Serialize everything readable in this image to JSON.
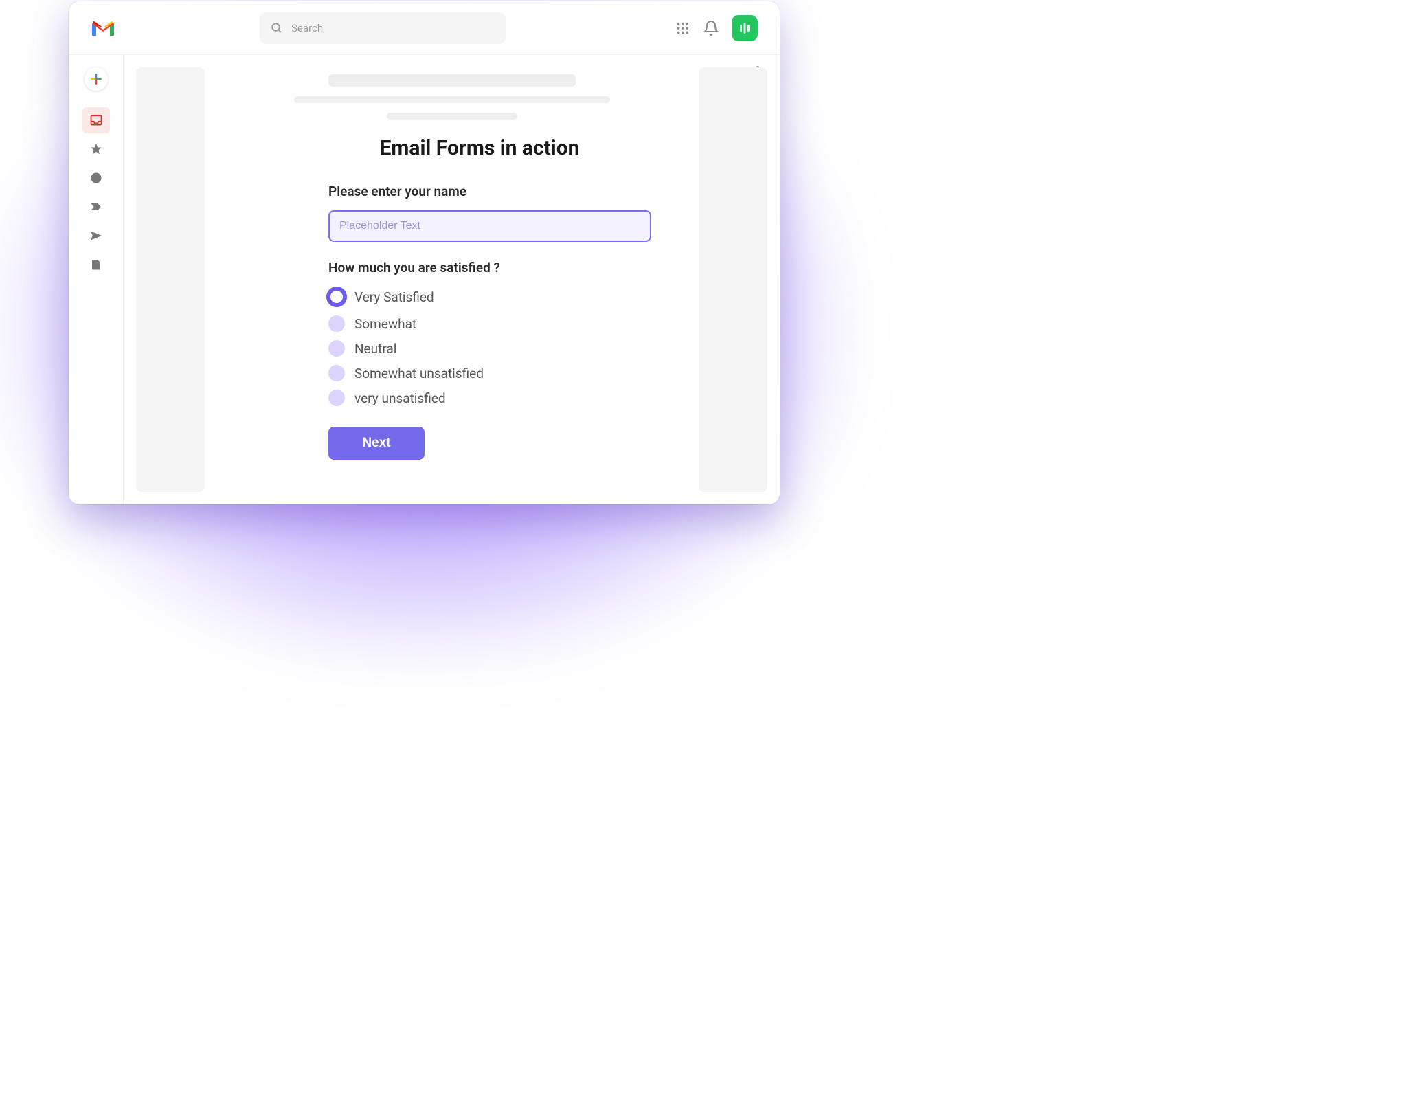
{
  "header": {
    "search_placeholder": "Search"
  },
  "sidebar": {
    "items": [
      {
        "name": "compose"
      },
      {
        "name": "inbox",
        "active": true
      },
      {
        "name": "starred"
      },
      {
        "name": "snoozed"
      },
      {
        "name": "important"
      },
      {
        "name": "sent"
      },
      {
        "name": "drafts"
      }
    ]
  },
  "form": {
    "title": "Email Forms in action",
    "name_label": "Please enter your name",
    "name_placeholder": "Placeholder Text",
    "satisfaction_label": "How much you are satisfied ?",
    "options": [
      {
        "label": "Very Satisfied",
        "selected": true
      },
      {
        "label": "Somewhat",
        "selected": false
      },
      {
        "label": "Neutral",
        "selected": false
      },
      {
        "label": "Somewhat unsatisfied",
        "selected": false
      },
      {
        "label": "very unsatisfied",
        "selected": false
      }
    ],
    "next_button": "Next"
  }
}
